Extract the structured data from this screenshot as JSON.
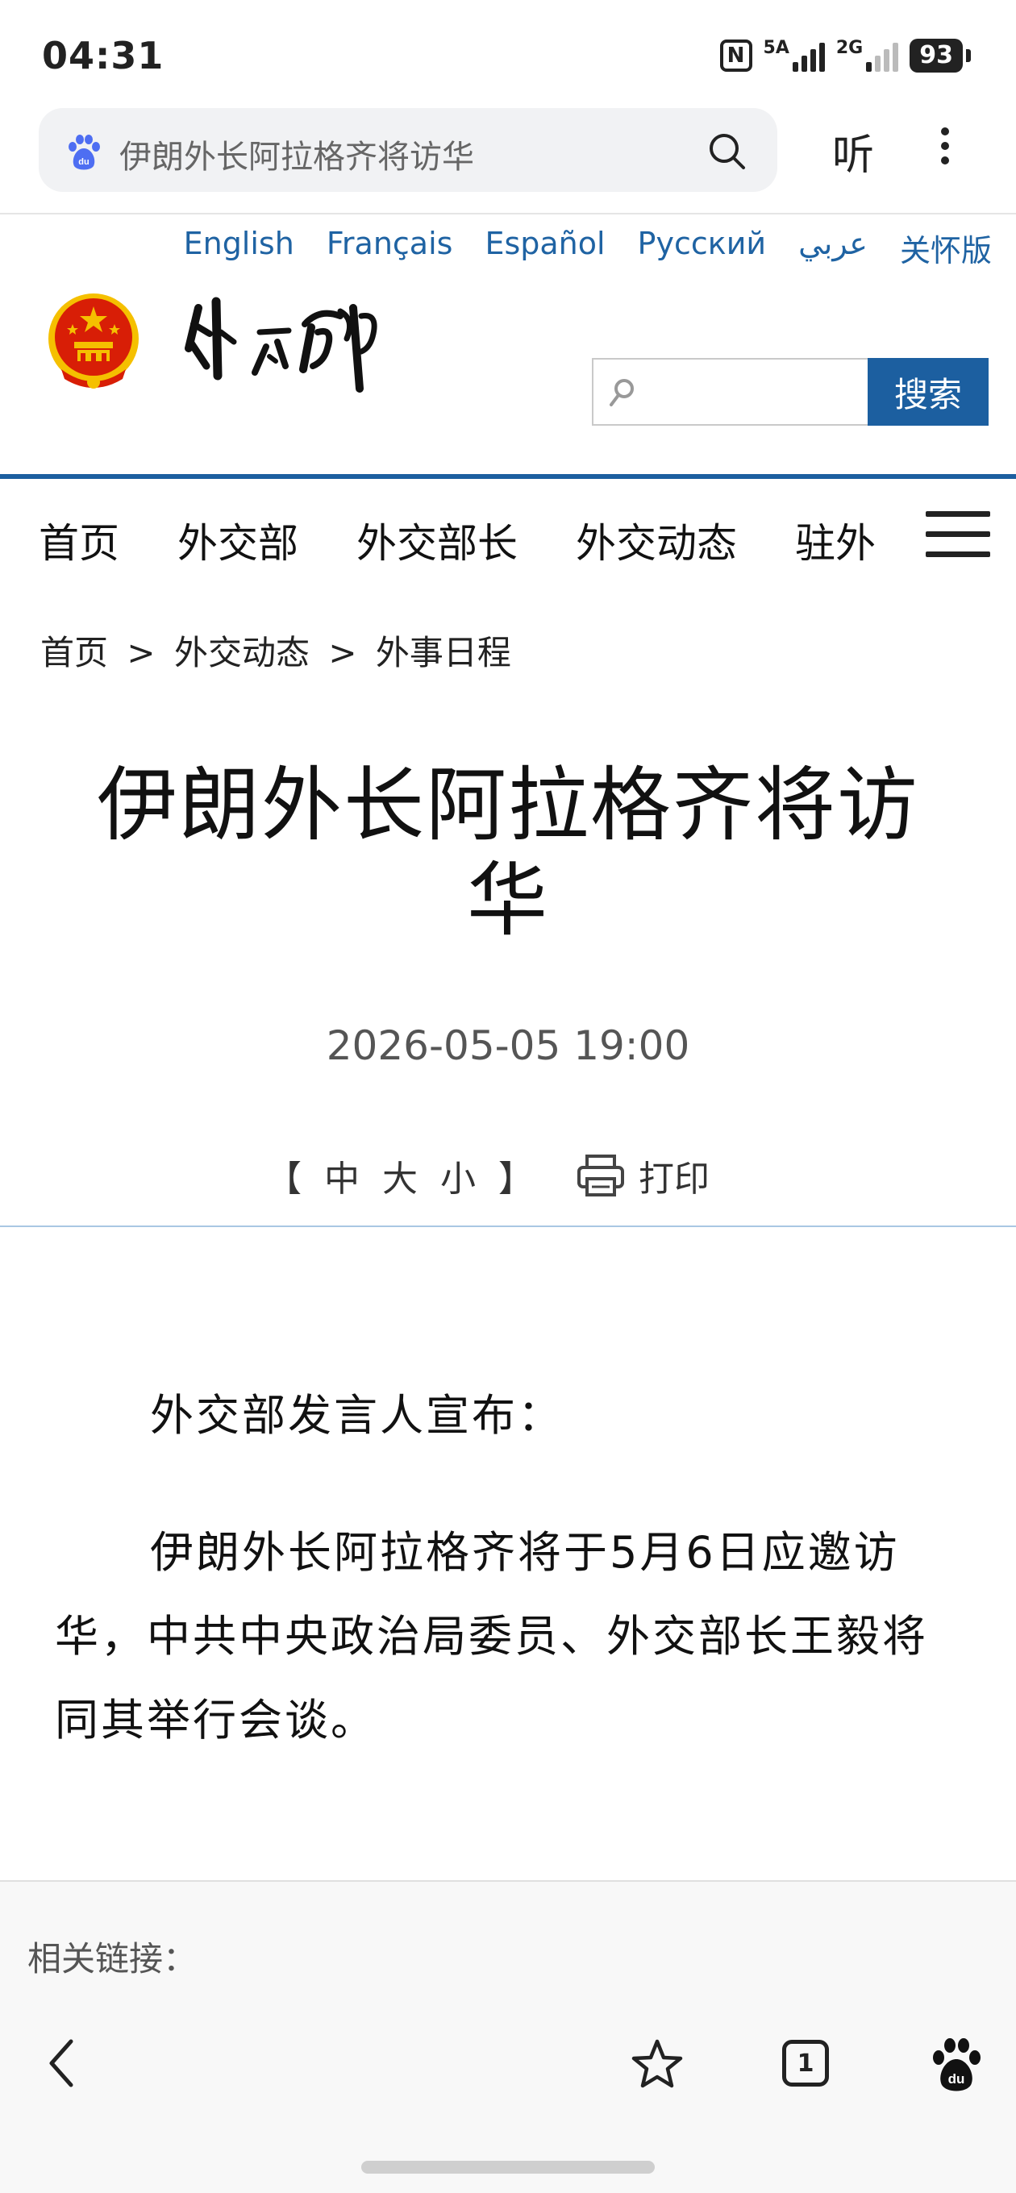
{
  "status_bar": {
    "time": "04:31",
    "nfc": "N",
    "network1": "5A",
    "network2": "2G",
    "battery": "93"
  },
  "browser": {
    "query": "伊朗外长阿拉格齐将访华",
    "listen_label": "听"
  },
  "languages": [
    "English",
    "Français",
    "Español",
    "Русский",
    "عربي",
    "关怀版"
  ],
  "header": {
    "site_search_button": "搜索"
  },
  "nav": {
    "items": [
      "首页",
      "外交部",
      "外交部长",
      "外交动态",
      "驻外"
    ]
  },
  "breadcrumb": {
    "items": [
      "首页",
      "外交动态",
      "外事日程"
    ],
    "separator": ">"
  },
  "article": {
    "title": "伊朗外长阿拉格齐将访华",
    "date": "2026-05-05 19:00",
    "font_size": {
      "open": "【",
      "medium": "中",
      "large": "大",
      "small": "小",
      "close": "】"
    },
    "print_label": "打印",
    "paragraphs": [
      "外交部发言人宣布：",
      "伊朗外长阿拉格齐将于5月6日应邀访华，中共中央政治局委员、外交部长王毅将同其举行会谈。"
    ]
  },
  "related": {
    "label": "相关链接："
  },
  "bottom_bar": {
    "tabs_count": "1"
  },
  "colors": {
    "accent_blue": "#1c5fa0",
    "link_blue": "#1f63a3",
    "emblem_red": "#d81e06",
    "emblem_gold": "#f5c000"
  }
}
